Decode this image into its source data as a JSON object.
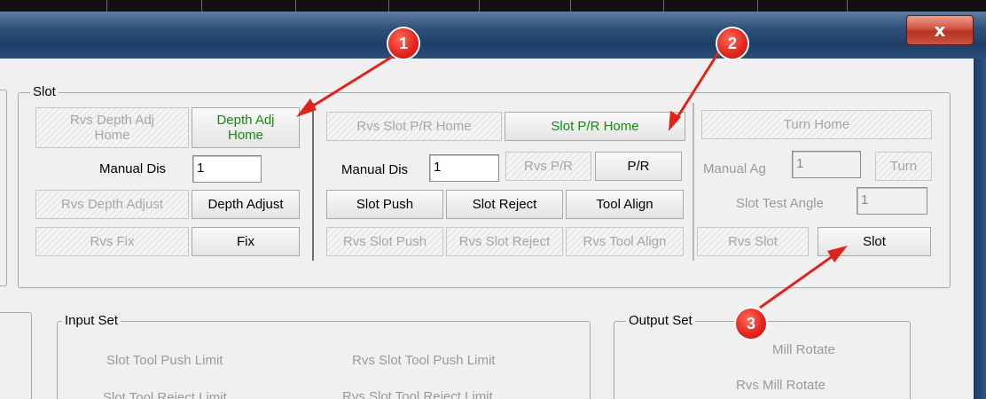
{
  "window": {
    "close_glyph": "x"
  },
  "slot_group": {
    "title": "Slot",
    "depth": {
      "rvs_home": [
        "Rvs Depth Adj",
        "Home"
      ],
      "home": [
        "Depth Adj",
        "Home"
      ],
      "manual_dis_label": "Manual Dis",
      "manual_dis_value": "1",
      "rvs_adjust": "Rvs Depth Adjust",
      "adjust": "Depth Adjust",
      "rvs_fix": "Rvs Fix",
      "fix": "Fix"
    },
    "pr": {
      "rvs_home": "Rvs Slot P/R Home",
      "home": "Slot P/R Home",
      "manual_dis_label": "Manual Dis",
      "manual_dis_value": "1",
      "rvs_pr": "Rvs P/R",
      "pr": "P/R",
      "push": "Slot Push",
      "reject": "Slot Reject",
      "tool_align": "Tool Align",
      "rvs_push": "Rvs Slot Push",
      "rvs_reject": "Rvs Slot Reject",
      "rvs_tool_align": "Rvs Tool Align"
    },
    "turn": {
      "home": "Turn Home",
      "manual_ag_label": "Manual Ag",
      "manual_ag_value": "1",
      "turn": "Turn",
      "test_angle_label": "Slot Test Angle",
      "test_angle_value": "1",
      "rvs_slot": "Rvs Slot",
      "slot": "Slot"
    }
  },
  "input_set": {
    "title": "Input Set",
    "items": [
      "Slot Tool Push Limit",
      "Rvs Slot Tool Push Limit",
      "Slot Tool Reject Limit",
      "Rvs Slot Tool Reject Limit"
    ]
  },
  "output_set": {
    "title": "Output Set",
    "items": [
      "Mill Rotate",
      "Rvs Mill Rotate"
    ]
  },
  "annotations": [
    "1",
    "2",
    "3"
  ],
  "colors": {
    "annotation_red": "#e2231a",
    "active_green": "#158a15",
    "titlebar_blue": "#2f5179"
  }
}
